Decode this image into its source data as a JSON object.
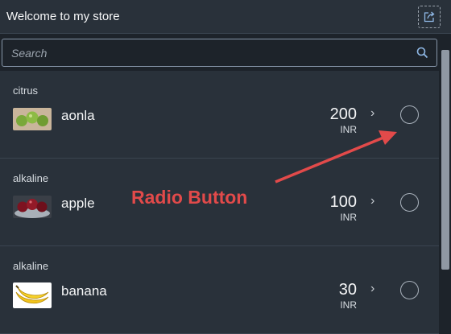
{
  "header": {
    "title": "Welcome to my store"
  },
  "search": {
    "placeholder": "Search",
    "value": ""
  },
  "products": [
    {
      "category": "citrus",
      "name": "aonla",
      "price": "200",
      "currency": "INR",
      "selected": false
    },
    {
      "category": "alkaline",
      "name": "apple",
      "price": "100",
      "currency": "INR",
      "selected": false
    },
    {
      "category": "alkaline",
      "name": "banana",
      "price": "30",
      "currency": "INR",
      "selected": false
    }
  ],
  "annotation": {
    "label": "Radio Button"
  },
  "colors": {
    "accent": "#e24a4a",
    "background": "#1d232a",
    "panel": "#29313a"
  },
  "icons": {
    "share": "share-icon",
    "search": "search-icon",
    "chevron": "chevron-right-icon"
  }
}
